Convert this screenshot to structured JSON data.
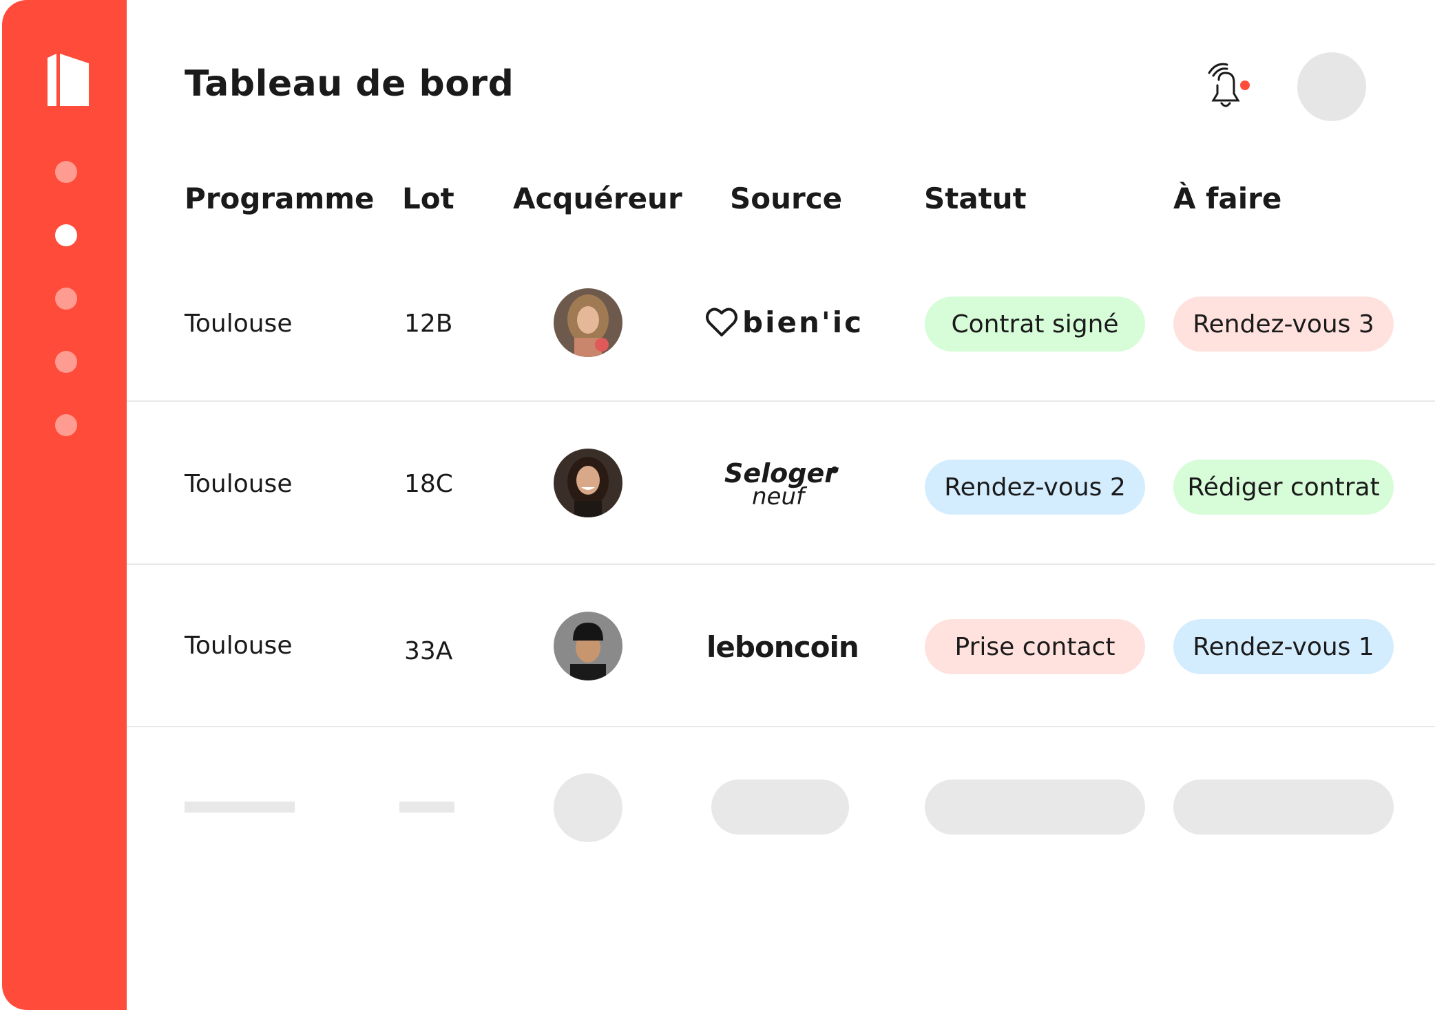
{
  "header": {
    "title": "Tableau de bord"
  },
  "sidebar": {
    "items": [
      {
        "id": "nav-1",
        "active": false
      },
      {
        "id": "nav-2",
        "active": true
      },
      {
        "id": "nav-3",
        "active": false
      },
      {
        "id": "nav-4",
        "active": false
      },
      {
        "id": "nav-5",
        "active": false
      }
    ]
  },
  "table": {
    "columns": [
      "Programme",
      "Lot",
      "Acquéreur",
      "Source",
      "Statut",
      "À faire"
    ],
    "rows": [
      {
        "programme": "Toulouse",
        "lot": "12B",
        "buyer_avatar": "buyer-photo-woman-long-hair",
        "source": "bien'ici",
        "statut": "Contrat signé",
        "a_faire": "Rendez-vous 3"
      },
      {
        "programme": "Toulouse",
        "lot": "18C",
        "buyer_avatar": "buyer-photo-woman-smiling",
        "source_line1": "Seloger",
        "source_line2": "neuf",
        "statut": "Rendez-vous 2",
        "a_faire": "Rédiger contrat"
      },
      {
        "programme": "Toulouse",
        "lot": "33A",
        "buyer_avatar": "buyer-photo-man-beanie",
        "source": "leboncoin",
        "statut": "Prise contact",
        "a_faire": "Rendez-vous 1"
      }
    ]
  },
  "colors": {
    "brand": "#ff4b3a",
    "pill_green": "#d6fcd8",
    "pill_pink": "#ffe1de",
    "pill_blue": "#d3edff",
    "skeleton": "#e8e8e8"
  }
}
